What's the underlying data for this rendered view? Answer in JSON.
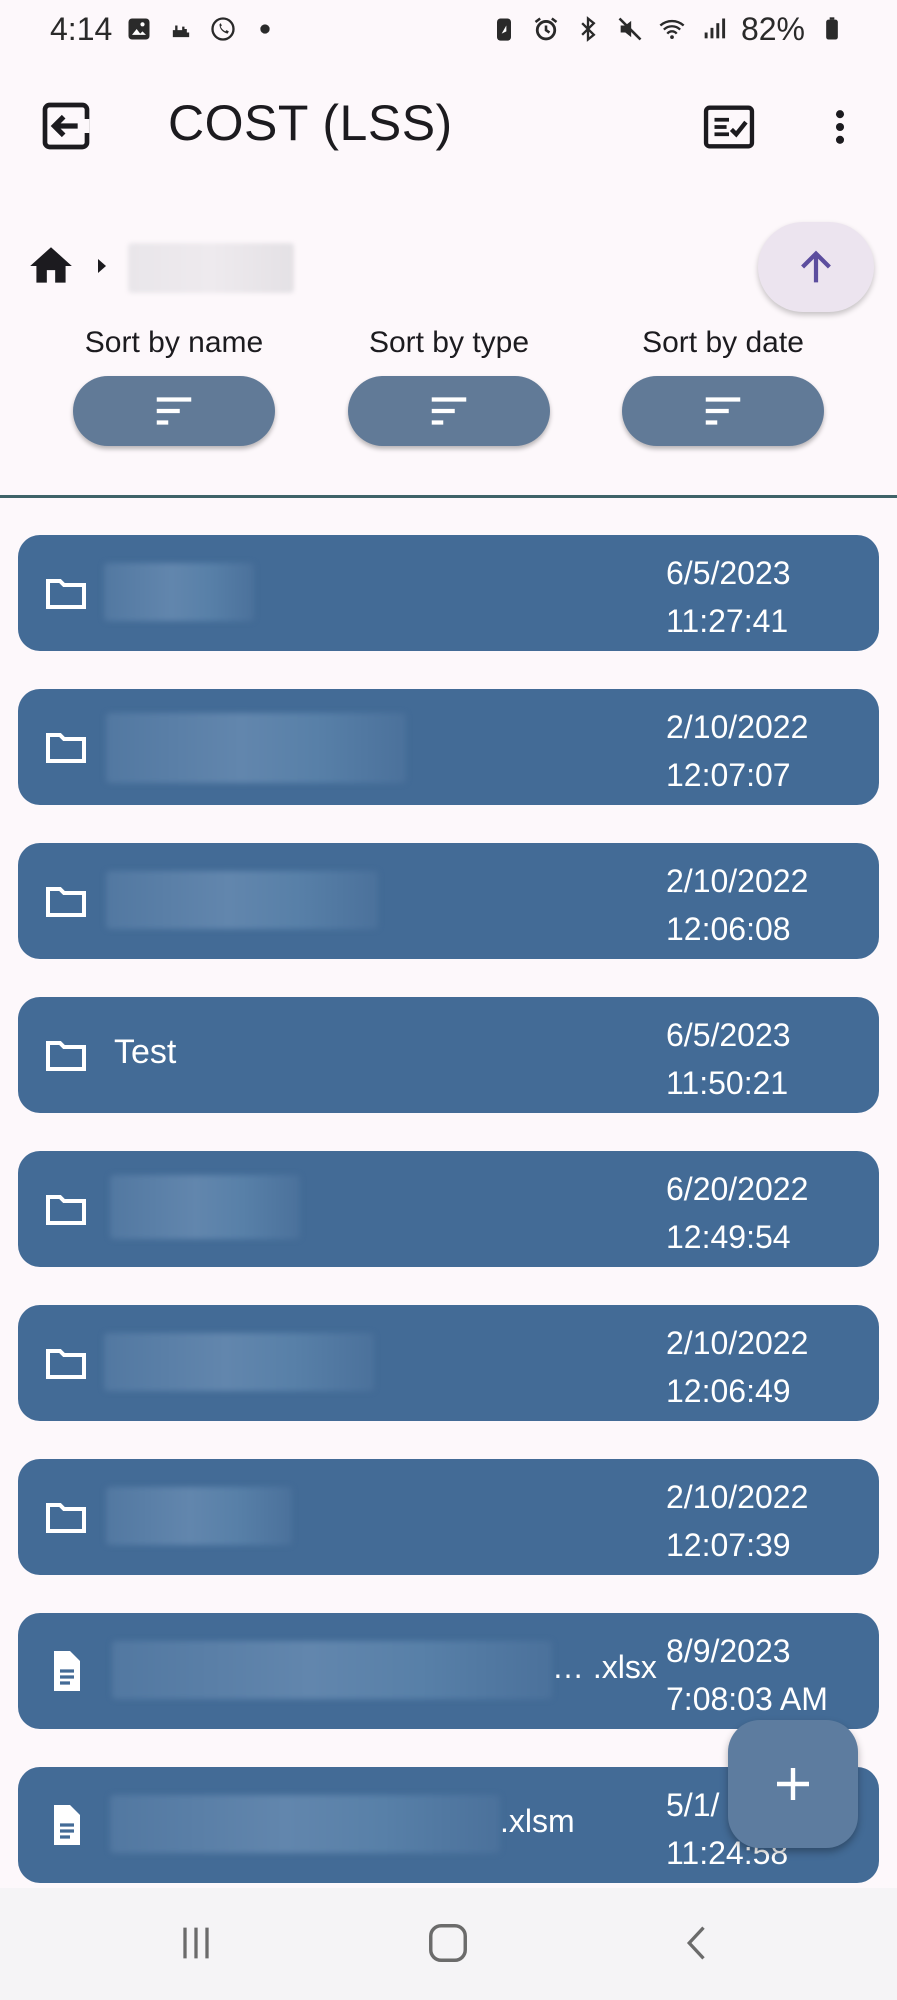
{
  "status_bar": {
    "time": "4:14",
    "battery": "82%",
    "left_icons": [
      "gallery-icon",
      "cloud-icon",
      "whatsapp-icon",
      "dot-icon"
    ],
    "right_icons": [
      "battery-saver-icon",
      "alarm-icon",
      "bluetooth-icon",
      "mute-icon",
      "wifi-icon",
      "signal-icon",
      "battery-icon"
    ]
  },
  "app_bar": {
    "title": "COST (LSS)",
    "back_icon": "exit-back-icon",
    "select_icon": "checklist-icon",
    "more_icon": "more-vert-icon"
  },
  "breadcrumb": {
    "home_icon": "home-icon",
    "separator_icon": "arrow-right-icon",
    "current": ""
  },
  "up_button": {
    "icon": "arrow-up-icon"
  },
  "sort": [
    {
      "label": "Sort by name",
      "icon": "sort-icon"
    },
    {
      "label": "Sort by type",
      "icon": "sort-icon"
    },
    {
      "label": "Sort by date",
      "icon": "sort-icon"
    }
  ],
  "items": [
    {
      "type": "folder",
      "name": "",
      "ext": "",
      "date": "6/5/2023",
      "time": "11:27:41"
    },
    {
      "type": "folder",
      "name": "",
      "ext": "",
      "date": "2/10/2022",
      "time": "12:07:07"
    },
    {
      "type": "folder",
      "name": "",
      "ext": "",
      "date": "2/10/2022",
      "time": "12:06:08"
    },
    {
      "type": "folder",
      "name": "Test",
      "ext": "",
      "date": "6/5/2023",
      "time": "11:50:21"
    },
    {
      "type": "folder",
      "name": "",
      "ext": "",
      "date": "6/20/2022",
      "time": "12:49:54"
    },
    {
      "type": "folder",
      "name": "",
      "ext": "",
      "date": "2/10/2022",
      "time": "12:06:49"
    },
    {
      "type": "folder",
      "name": "",
      "ext": "",
      "date": "2/10/2022",
      "time": "12:07:39"
    },
    {
      "type": "file",
      "name": "",
      "ext": "… .xlsx",
      "date": "8/9/2023",
      "time": "7:08:03 AM"
    },
    {
      "type": "file",
      "name": "",
      "ext": ".xlsm",
      "date": "5/1/",
      "time": "11:24:58"
    }
  ],
  "add_button": {
    "icon": "plus-icon"
  },
  "nav_bar": {
    "icons": [
      "recents-icon",
      "home-nav-icon",
      "back-nav-icon"
    ]
  }
}
